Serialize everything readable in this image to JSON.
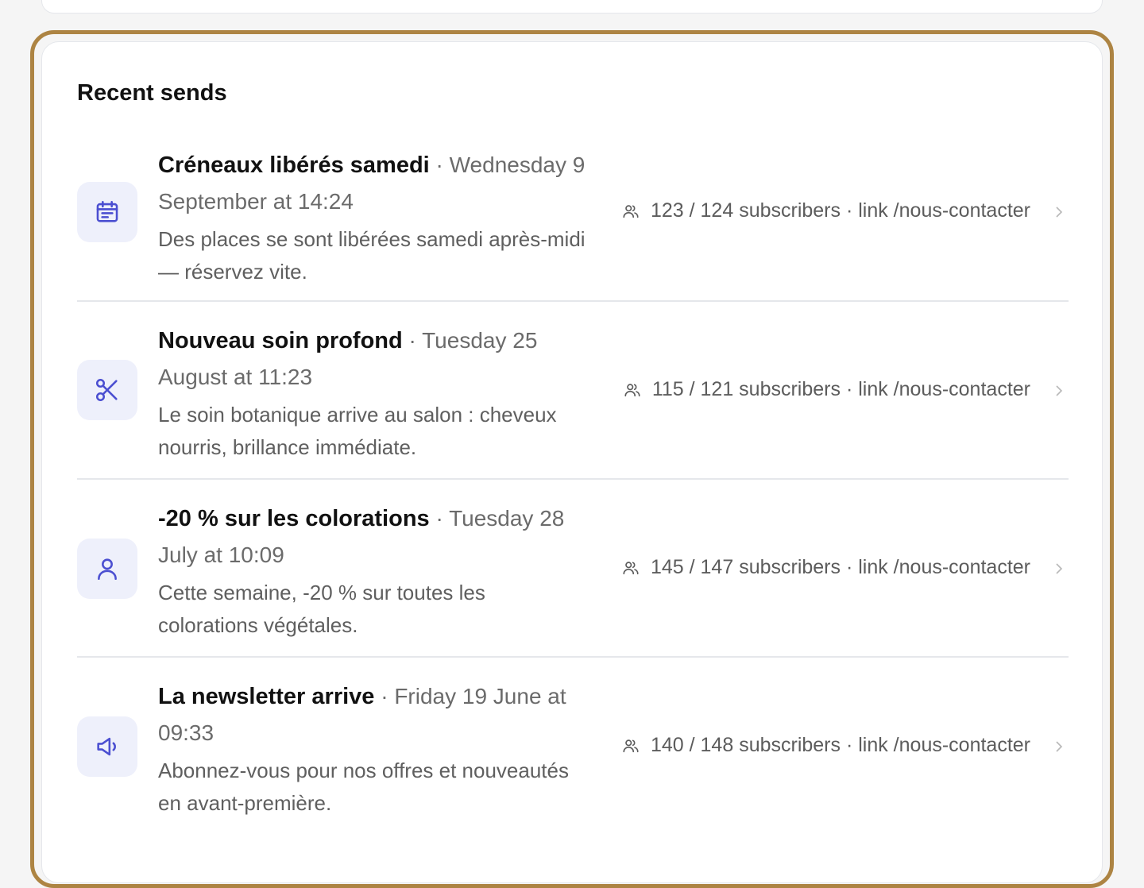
{
  "section": {
    "title": "Recent sends"
  },
  "items": [
    {
      "icon": "calendar-icon",
      "title": "Créneaux libérés samedi",
      "date": "Wednesday 9 September at 14:24",
      "body": "Des places se sont libérées samedi après-midi — réservez vite.",
      "meta": "123 / 124 subscribers · link /nous-contacter"
    },
    {
      "icon": "scissors-icon",
      "title": "Nouveau soin profond",
      "date": "Tuesday 25 August at 11:23",
      "body": "Le soin botanique arrive au salon : cheveux nourris, brillance immédiate.",
      "meta": "115 / 121 subscribers · link /nous-contacter"
    },
    {
      "icon": "user-icon",
      "title": "-20 % sur les colorations",
      "date": "Tuesday 28 July at 10:09",
      "body": "Cette semaine, -20 % sur toutes les colorations végétales.",
      "meta": "145 / 147 subscribers · link /nous-contacter"
    },
    {
      "icon": "megaphone-icon",
      "title": "La newsletter arrive",
      "date": "Friday 19 June at 09:33",
      "body": "Abonnez-vous pour nos offres et nouveautés en avant-première.",
      "meta": "140 / 148 subscribers · link /nous-contacter"
    }
  ],
  "colors": {
    "accent": "#4b4fd1",
    "icon_bg": "#eef0fb",
    "highlight_border": "#ad8443"
  }
}
